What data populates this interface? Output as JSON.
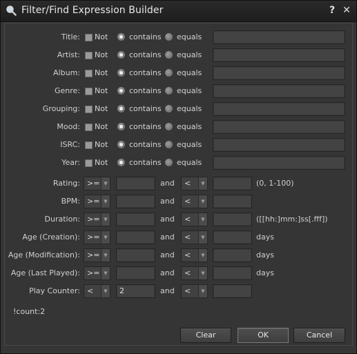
{
  "window": {
    "title": "Filter/Find Expression Builder",
    "help_symbol": "?",
    "close_symbol": "✕"
  },
  "text_rows": [
    {
      "label": "Title:",
      "not_label": "Not",
      "contains_label": "contains",
      "equals_label": "equals",
      "contains_selected": true,
      "not_checked": false,
      "value": ""
    },
    {
      "label": "Artist:",
      "not_label": "Not",
      "contains_label": "contains",
      "equals_label": "equals",
      "contains_selected": true,
      "not_checked": false,
      "value": ""
    },
    {
      "label": "Album:",
      "not_label": "Not",
      "contains_label": "contains",
      "equals_label": "equals",
      "contains_selected": true,
      "not_checked": false,
      "value": ""
    },
    {
      "label": "Genre:",
      "not_label": "Not",
      "contains_label": "contains",
      "equals_label": "equals",
      "contains_selected": true,
      "not_checked": false,
      "value": ""
    },
    {
      "label": "Grouping:",
      "not_label": "Not",
      "contains_label": "contains",
      "equals_label": "equals",
      "contains_selected": true,
      "not_checked": false,
      "value": ""
    },
    {
      "label": "Mood:",
      "not_label": "Not",
      "contains_label": "contains",
      "equals_label": "equals",
      "contains_selected": true,
      "not_checked": false,
      "value": ""
    },
    {
      "label": "ISRC:",
      "not_label": "Not",
      "contains_label": "contains",
      "equals_label": "equals",
      "contains_selected": true,
      "not_checked": false,
      "value": ""
    },
    {
      "label": "Year:",
      "not_label": "Not",
      "contains_label": "contains",
      "equals_label": "equals",
      "contains_selected": true,
      "not_checked": false,
      "value": ""
    }
  ],
  "range_rows": [
    {
      "label": "Rating:",
      "op1": ">=",
      "val1": "",
      "and_label": "and",
      "op2": "<",
      "val2": "",
      "hint": "(0, 1-100)"
    },
    {
      "label": "BPM:",
      "op1": ">=",
      "val1": "",
      "and_label": "and",
      "op2": "<",
      "val2": "",
      "hint": ""
    },
    {
      "label": "Duration:",
      "op1": ">=",
      "val1": "",
      "and_label": "and",
      "op2": "<",
      "val2": "",
      "hint": "([[hh:]mm:]ss[.fff])"
    },
    {
      "label": "Age (Creation):",
      "op1": ">=",
      "val1": "",
      "and_label": "and",
      "op2": "<",
      "val2": "",
      "hint": "days"
    },
    {
      "label": "Age (Modification):",
      "op1": ">=",
      "val1": "",
      "and_label": "and",
      "op2": "<",
      "val2": "",
      "hint": "days"
    },
    {
      "label": "Age (Last Played):",
      "op1": ">=",
      "val1": "",
      "and_label": "and",
      "op2": "<",
      "val2": "",
      "hint": "days"
    },
    {
      "label": "Play Counter:",
      "op1": "<",
      "val1": "2",
      "and_label": "and",
      "op2": "<",
      "val2": "",
      "hint": ""
    }
  ],
  "expression": "!count:2",
  "buttons": {
    "clear": "Clear",
    "ok": "OK",
    "cancel": "Cancel"
  }
}
